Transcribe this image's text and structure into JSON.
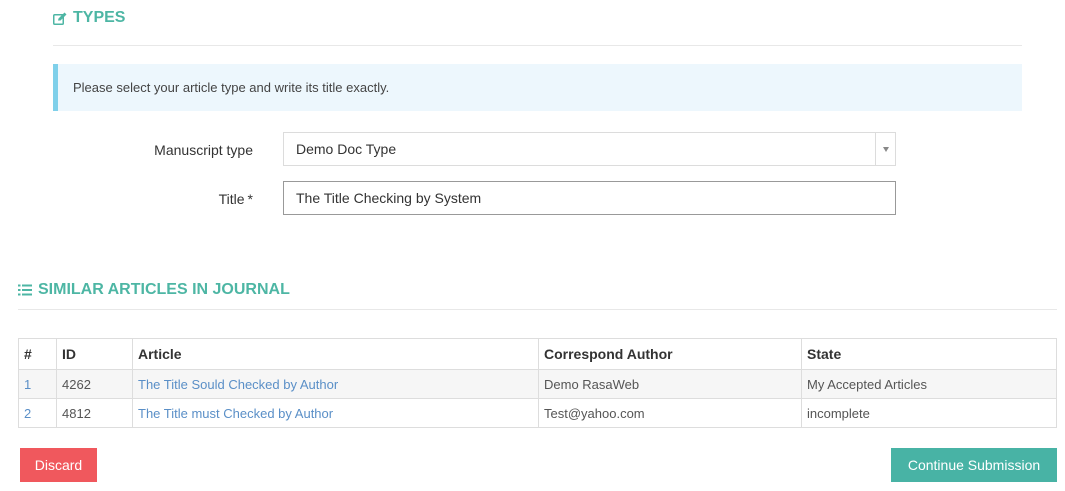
{
  "types_section": {
    "title": "TYPES",
    "icon": "edit-icon",
    "info_text": "Please select your article type and write its title exactly."
  },
  "form": {
    "manuscript_type_label": "Manuscript type",
    "manuscript_type_value": "Demo Doc Type",
    "title_label": "Title",
    "title_required": "*",
    "title_value": "The Title Checking by System"
  },
  "similar_section": {
    "title": "SIMILAR ARTICLES IN JOURNAL",
    "icon": "list-icon",
    "columns": [
      "#",
      "ID",
      "Article",
      "Correspond Author",
      "State"
    ],
    "rows": [
      {
        "num": "1",
        "id": "4262",
        "article": "The Title Sould Checked by Author",
        "author": "Demo RasaWeb",
        "state": "My Accepted Articles"
      },
      {
        "num": "2",
        "id": "4812",
        "article": "The Title must Checked by Author",
        "author": "Test@yahoo.com",
        "state": "incomplete"
      }
    ]
  },
  "actions": {
    "discard_label": "Discard",
    "continue_label": "Continue Submission"
  },
  "colors": {
    "accent": "#4db6a4",
    "discard": "#f0585d",
    "continue": "#48b3a5",
    "link": "#5a8fc7",
    "info_bg": "#edf7fd",
    "info_border": "#7fd0ea"
  }
}
